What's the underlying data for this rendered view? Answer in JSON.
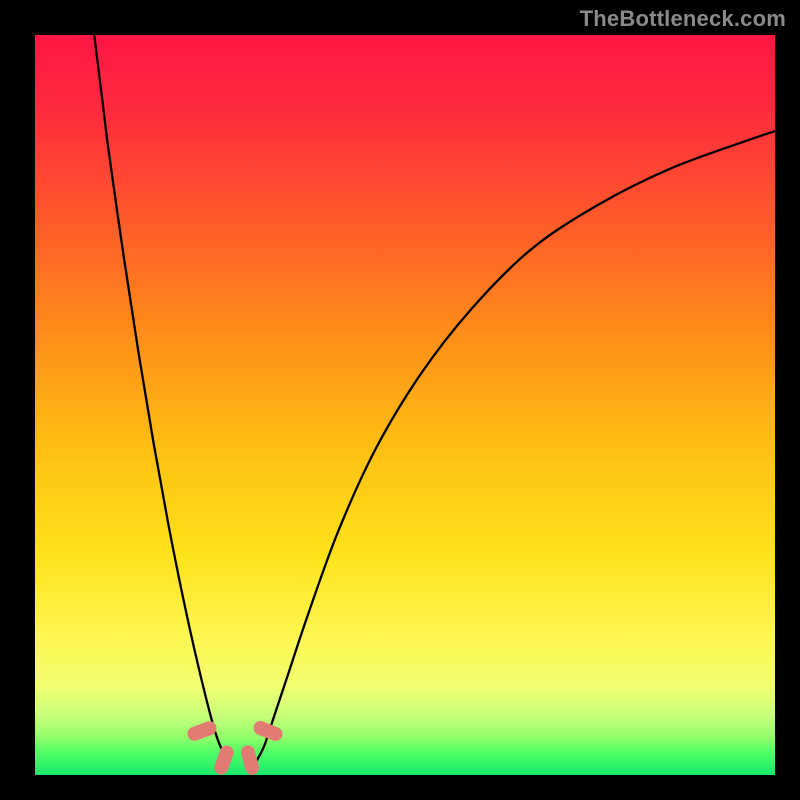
{
  "watermark": "TheBottleneck.com",
  "chart_data": {
    "type": "line",
    "title": "",
    "xlabel": "",
    "ylabel": "",
    "xlim": [
      0,
      100
    ],
    "ylim": [
      0,
      100
    ],
    "series": [
      {
        "name": "left-branch",
        "x": [
          8,
          9,
          10,
          12,
          14,
          16,
          18,
          20,
          22,
          24,
          25,
          26
        ],
        "y": [
          100,
          92,
          84,
          70,
          57,
          45,
          34,
          24,
          15,
          7,
          4,
          2
        ]
      },
      {
        "name": "right-branch",
        "x": [
          30,
          31,
          32,
          34,
          37,
          41,
          46,
          52,
          59,
          67,
          76,
          86,
          97,
          100
        ],
        "y": [
          2,
          4,
          7,
          13,
          22,
          33,
          44,
          54,
          63,
          71,
          77,
          82,
          86,
          87
        ]
      }
    ],
    "markers": [
      {
        "name": "dip-left",
        "x": 22.5,
        "y": 6,
        "angle_deg": 70
      },
      {
        "name": "dip-bottom-left",
        "x": 25.5,
        "y": 2,
        "angle_deg": 20
      },
      {
        "name": "dip-bottom-right",
        "x": 29.0,
        "y": 2,
        "angle_deg": -15
      },
      {
        "name": "dip-right",
        "x": 31.5,
        "y": 6,
        "angle_deg": -68
      }
    ],
    "background_gradient": [
      {
        "pos": 0,
        "color": "#ff1744"
      },
      {
        "pos": 10,
        "color": "#ff2a3e"
      },
      {
        "pos": 25,
        "color": "#ff5a2a"
      },
      {
        "pos": 40,
        "color": "#ff8c1a"
      },
      {
        "pos": 55,
        "color": "#ffbd12"
      },
      {
        "pos": 70,
        "color": "#ffe21a"
      },
      {
        "pos": 80,
        "color": "#fff44a"
      },
      {
        "pos": 88,
        "color": "#f2ff70"
      },
      {
        "pos": 92,
        "color": "#c8ff7a"
      },
      {
        "pos": 95,
        "color": "#8eff6a"
      },
      {
        "pos": 97,
        "color": "#4dff66"
      },
      {
        "pos": 100,
        "color": "#19e86b"
      }
    ]
  }
}
